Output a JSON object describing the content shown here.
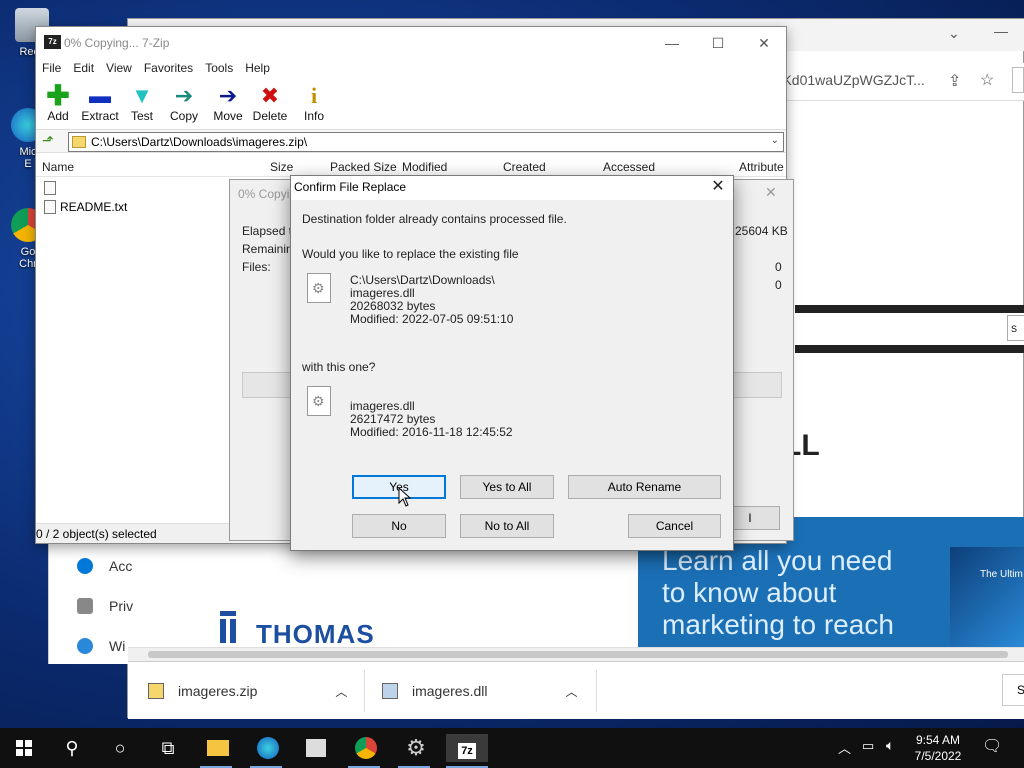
{
  "desktop": {
    "icons": [
      {
        "label": "Recy"
      },
      {
        "label": "Mic"
      },
      {
        "label": "E"
      },
      {
        "label": "Go"
      },
      {
        "label": "Chr"
      }
    ]
  },
  "browser": {
    "address_fragment": "JjVKd01waUZpWGZJcT...",
    "banner_text": "Learn all you need to know about marketing to reach",
    "banner_side_text": "The Ultim",
    "logo_text": "THOMAS",
    "big_letter": "LL",
    "search_fragment": "S",
    "downloads": [
      {
        "name": "imageres.zip"
      },
      {
        "name": "imageres.dll"
      }
    ],
    "side_items": [
      {
        "label": "Acc"
      },
      {
        "label": "Priv"
      },
      {
        "label": "Wi"
      }
    ]
  },
  "zip": {
    "title": "0% Copying... 7-Zip",
    "logo": "7z",
    "menu": [
      "File",
      "Edit",
      "View",
      "Favorites",
      "Tools",
      "Help"
    ],
    "tools": [
      {
        "label": "Add",
        "glyph": "+",
        "color": "#1aa31a"
      },
      {
        "label": "Extract",
        "glyph": "▬",
        "color": "#1030c0"
      },
      {
        "label": "Test",
        "glyph": "▼",
        "color": "#22c0c0"
      },
      {
        "label": "Copy",
        "glyph": "➔",
        "color": "#1a8a7a"
      },
      {
        "label": "Move",
        "glyph": "➔",
        "color": "#0a1a8a"
      },
      {
        "label": "Delete",
        "glyph": "✖",
        "color": "#d01010"
      },
      {
        "label": "Info",
        "glyph": "i",
        "color": "#c09000"
      }
    ],
    "path": "C:\\Users\\Dartz\\Downloads\\imageres.zip\\",
    "columns": [
      "Name",
      "Size",
      "Packed Size",
      "Modified",
      "Created",
      "Accessed",
      "Attribute"
    ],
    "files": [
      {
        "name": ""
      },
      {
        "name": "README.txt"
      }
    ],
    "status": "0 / 2 object(s) selected"
  },
  "progress": {
    "title": "0% Copyi",
    "labels": [
      "Elapsed ti",
      "Remaining",
      "Files:"
    ],
    "values": [
      "25604 KB",
      "0",
      "0"
    ],
    "button_fragment": "l"
  },
  "dialog": {
    "title": "Confirm File Replace",
    "line1": "Destination folder already contains processed file.",
    "line2": "Would you like to replace the existing file",
    "existing": {
      "path": "C:\\Users\\Dartz\\Downloads\\",
      "name": "imageres.dll",
      "size": "20268032 bytes",
      "modified": "Modified: 2022-07-05 09:51:10"
    },
    "with_text": "with this one?",
    "incoming": {
      "name": "imageres.dll",
      "size": "26217472 bytes",
      "modified": "Modified: 2016-11-18 12:45:52"
    },
    "buttons": {
      "yes": "Yes",
      "yes_all": "Yes to All",
      "auto_rename": "Auto Rename",
      "no": "No",
      "no_all": "No to All",
      "cancel": "Cancel"
    }
  },
  "taskbar": {
    "time": "9:54 AM",
    "date": "7/5/2022",
    "zip_label": "7z"
  }
}
